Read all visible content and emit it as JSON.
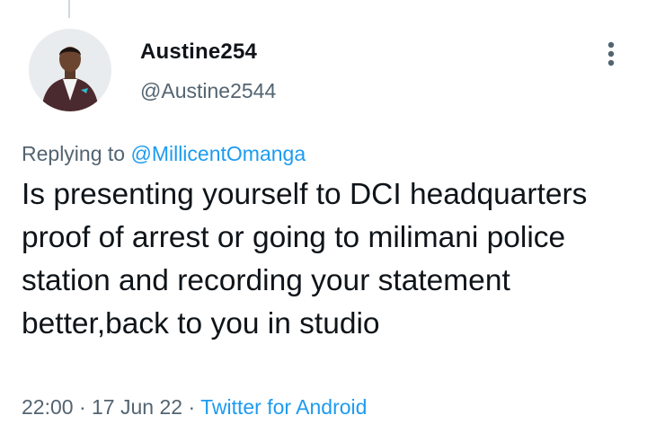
{
  "tweet": {
    "author": {
      "display_name": "Austine254",
      "handle": "@Austine2544"
    },
    "replying_to": {
      "prefix": "Replying to",
      "mention": "@MillicentOmanga"
    },
    "text": "Is presenting yourself to DCI headquarters proof of arrest or going to milimani police station and recording your statement better,back to you in studio",
    "time": "22:00",
    "separator": "·",
    "date": "17 Jun 22",
    "source": "Twitter for Android"
  },
  "icons": {
    "more": "more-vertical-icon",
    "avatar": "avatar-photo"
  },
  "colors": {
    "link": "#1d9bf0",
    "secondary_text": "#536471",
    "primary_text": "#0f1419"
  }
}
